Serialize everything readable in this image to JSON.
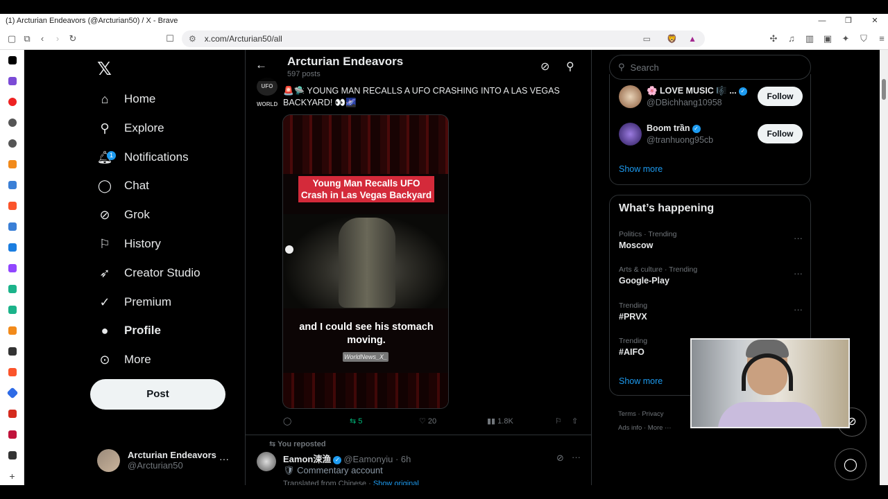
{
  "window": {
    "title": "(1) Arcturian Endeavors (@Arcturian50) / X - Brave",
    "controls": [
      "—",
      "❐",
      "✕"
    ]
  },
  "browser": {
    "url": "x.com/Arcturian50/all"
  },
  "nav": {
    "items": [
      {
        "label": "Home",
        "icon": "home-icon"
      },
      {
        "label": "Explore",
        "icon": "search-icon"
      },
      {
        "label": "Notifications",
        "icon": "bell-icon",
        "badge": "1"
      },
      {
        "label": "Chat",
        "icon": "chat-icon"
      },
      {
        "label": "Grok",
        "icon": "grok-icon"
      },
      {
        "label": "History",
        "icon": "bookmark-icon"
      },
      {
        "label": "Creator Studio",
        "icon": "rocket-icon"
      },
      {
        "label": "Premium",
        "icon": "verified-icon"
      },
      {
        "label": "Profile",
        "icon": "person-icon"
      },
      {
        "label": "More",
        "icon": "more-icon"
      }
    ],
    "post_label": "Post",
    "account": {
      "name": "Arcturian Endeavors",
      "handle": "@Arcturian50",
      "more": "···"
    }
  },
  "profile_header": {
    "title": "Arcturian Endeavors",
    "subtitle": "597 posts"
  },
  "tweet": {
    "avatar_text": "UFO WORLD",
    "text": "🚨🛸 YOUNG MAN RECALLS A UFO CRASHING INTO A LAS VEGAS BACKYARD! 👀🌌",
    "media": {
      "caption_line1": "Young Man Recalls UFO",
      "caption_line2": "Crash in Las Vegas Backyard",
      "subtitle": "and I could see his stomach moving.",
      "watermark": "WorldNews_X_"
    },
    "actions": {
      "reposts": "5",
      "likes": "20",
      "views": "1.8K"
    }
  },
  "tweet2": {
    "repost_note": "You reposted",
    "name": "Eamon涑渔",
    "handle": "@Eamonyiu",
    "time": "· 6h",
    "subtitle": "Commentary account",
    "translated": "Translated from Chinese",
    "show_original": "Show original"
  },
  "right": {
    "search_placeholder": "Search",
    "who_to_follow": [
      {
        "name": "🌸 LOVE MUSIC 🎼 ...",
        "handle": "@DBichhang10958",
        "button": "Follow"
      },
      {
        "name": "Boom trần",
        "handle": "@tranhuong95cb",
        "button": "Follow"
      }
    ],
    "who_show_more": "Show more",
    "happening_title": "What’s happening",
    "trends": [
      {
        "category": "Politics · Trending",
        "name": "Moscow"
      },
      {
        "category": "Arts & culture · Trending",
        "name": "Google-Play"
      },
      {
        "category": "Trending",
        "name": "#PRVX"
      },
      {
        "category": "Trending",
        "name": "#AIFO"
      }
    ],
    "happening_show_more": "Show more",
    "footer": {
      "terms": "Terms",
      "privacy": "Privacy",
      "ads_info": "Ads info",
      "more": "More ···"
    }
  },
  "colors": {
    "accent": "#1d9bf0",
    "repost_green": "#00ba7c",
    "background": "#000000",
    "border": "#2f3336"
  }
}
